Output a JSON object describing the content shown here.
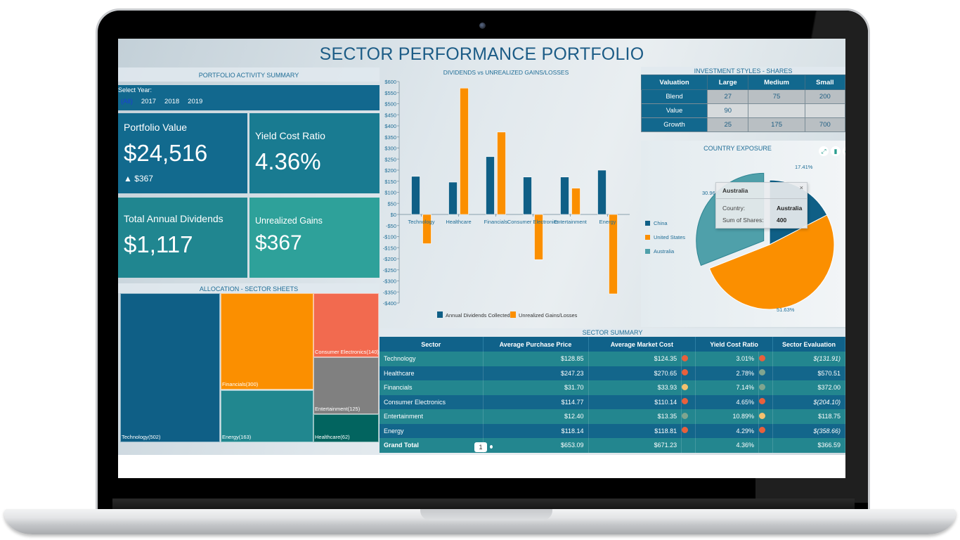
{
  "dashboard": {
    "title": "SECTOR PERFORMANCE PORTFOLIO"
  },
  "activity": {
    "title": "PORTFOLIO ACTIVITY SUMMARY",
    "select_year_label": "Select Year:",
    "years": [
      "(All)",
      "2017",
      "2018",
      "2019"
    ],
    "selected_year": "(All)",
    "kpis": {
      "portfolio_value": {
        "label": "Portfolio Value",
        "value": "$24,516",
        "delta": "$367",
        "delta_icon": "triangle-up"
      },
      "yield_cost_ratio": {
        "label": "Yield Cost Ratio",
        "value": "4.36%"
      },
      "total_annual_dividends": {
        "label": "Total Annual Dividends",
        "value": "$1,117"
      },
      "unrealized_gains": {
        "label": "Unrealized Gains",
        "value": "$367"
      }
    }
  },
  "allocation": {
    "title": "ALLOCATION - SECTOR SHEETS",
    "items": [
      {
        "label": "Technology(502)",
        "color": "#0f5f86"
      },
      {
        "label": "Financials(300)",
        "color": "#fb8f00"
      },
      {
        "label": "Energy(163)",
        "color": "#21878f"
      },
      {
        "label": "Consumer Electronics(140)",
        "color": "#f26a4f"
      },
      {
        "label": "Entertainment(125)",
        "color": "#808080"
      },
      {
        "label": "Healthcare(62)",
        "color": "#02645f"
      }
    ]
  },
  "investment_styles": {
    "title": "INVESTMENT STYLES - SHARES",
    "headers": [
      "Valuation",
      "Large",
      "Medium",
      "Small"
    ],
    "rows": [
      [
        "Blend",
        "27",
        "75",
        "200"
      ],
      [
        "Value",
        "90",
        "",
        ""
      ],
      [
        "Growth",
        "25",
        "175",
        "700"
      ]
    ]
  },
  "country_exposure": {
    "title": "COUNTRY EXPOSURE",
    "toolbar_icons": [
      "expand-icon",
      "export-icon",
      "more-icon"
    ],
    "tooltip": {
      "title": "Australia",
      "close": "×",
      "country_label": "Country:",
      "country_value": "Australia",
      "shares_label": "Sum of Shares:",
      "shares_value": "400"
    }
  },
  "sector_summary": {
    "title": "SECTOR SUMMARY",
    "headers": [
      "Sector",
      "Average Purchase Price",
      "Average Market Cost",
      "Yield Cost Ratio",
      "Sector Evaluation"
    ],
    "rows": [
      {
        "sector": "Technology",
        "purchase": "$128.85",
        "market": "$124.35",
        "market_ind": "#e8603c",
        "ycr": "3.01%",
        "ycr_ind": "#e8603c",
        "eval": "$(131.91)",
        "neg": true
      },
      {
        "sector": "Healthcare",
        "purchase": "$247.23",
        "market": "$270.65",
        "market_ind": "#e8603c",
        "ycr": "2.78%",
        "ycr_ind": "#7fa58f",
        "eval": "$570.51",
        "neg": false
      },
      {
        "sector": "Financials",
        "purchase": "$31.70",
        "market": "$33.93",
        "market_ind": "#f3c16e",
        "ycr": "7.14%",
        "ycr_ind": "#7fa58f",
        "eval": "$372.00",
        "neg": false
      },
      {
        "sector": "Consumer Electronics",
        "purchase": "$114.77",
        "market": "$110.14",
        "market_ind": "#e8603c",
        "ycr": "4.65%",
        "ycr_ind": "#e8603c",
        "eval": "$(204.10)",
        "neg": true
      },
      {
        "sector": "Entertainment",
        "purchase": "$12.40",
        "market": "$13.35",
        "market_ind": "#7fa58f",
        "ycr": "10.89%",
        "ycr_ind": "#f3c16e",
        "eval": "$118.75",
        "neg": false
      },
      {
        "sector": "Energy",
        "purchase": "$118.14",
        "market": "$118.81",
        "market_ind": "#e8603c",
        "ycr": "4.29%",
        "ycr_ind": "#e8603c",
        "eval": "$(358.66)",
        "neg": true
      },
      {
        "sector": "Grand Total",
        "purchase": "$653.09",
        "market": "$671.23",
        "market_ind": "",
        "ycr": "4.36%",
        "ycr_ind": "",
        "eval": "$366.59",
        "neg": false
      }
    ],
    "page": "1"
  },
  "chart_data": [
    {
      "type": "bar",
      "title": "DIVIDENDS vs UNREALIZED GAINS/LOSSES",
      "categories": [
        "Technology",
        "Healthcare",
        "Financials",
        "Consumer Electronics",
        "Entertainment",
        "Energy"
      ],
      "series": [
        {
          "name": "Annual Dividends Collected",
          "color": "#0f5f86",
          "values": [
            172,
            146,
            261,
            169,
            169,
            200
          ]
        },
        {
          "name": "Unrealized Gains/Losses",
          "color": "#fb8f00",
          "values": [
            -131.91,
            570.51,
            372.0,
            -204.1,
            118.75,
            -358.66
          ]
        }
      ],
      "ylim": [
        -400,
        600
      ],
      "yticks": [
        600,
        550,
        500,
        450,
        400,
        350,
        300,
        250,
        200,
        150,
        100,
        50,
        0,
        -50,
        -100,
        -150,
        -200,
        -250,
        -300,
        -350,
        -400
      ],
      "ytick_format": "$",
      "xlabel": "",
      "ylabel": "",
      "legend": "bottom",
      "grid": false
    },
    {
      "type": "pie",
      "title": "COUNTRY EXPOSURE",
      "labels": [
        "China",
        "United States",
        "Australia"
      ],
      "values": [
        17.41,
        51.63,
        30.96
      ],
      "colors": [
        "#0f5f86",
        "#fb8f00",
        "#4fa0aa"
      ],
      "exploded": "Australia",
      "legend": "left"
    }
  ]
}
